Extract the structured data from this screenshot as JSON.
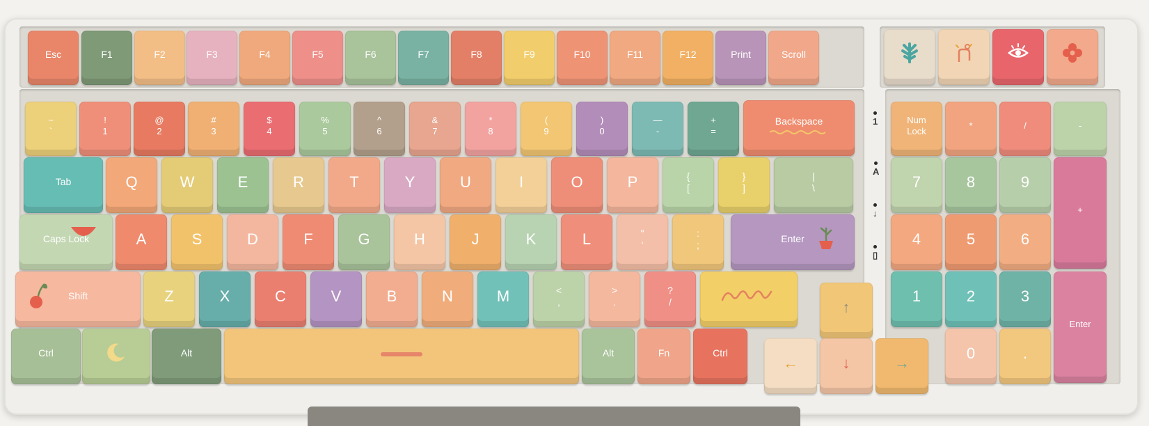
{
  "keyboard": {
    "function_row": [
      {
        "label": "Esc",
        "color": "#e9866a"
      },
      {
        "label": "F1",
        "color": "#7f9a77"
      },
      {
        "label": "F2",
        "color": "#f3be86"
      },
      {
        "label": "F3",
        "color": "#e7b2bf"
      },
      {
        "label": "F4",
        "color": "#f0a97d"
      },
      {
        "label": "F5",
        "color": "#ef8f8a"
      },
      {
        "label": "F6",
        "color": "#a9c39a"
      },
      {
        "label": "F7",
        "color": "#79b2a2"
      },
      {
        "label": "F8",
        "color": "#e47f67"
      },
      {
        "label": "F9",
        "color": "#f2cd6b"
      },
      {
        "label": "F10",
        "color": "#ef9375"
      },
      {
        "label": "F11",
        "color": "#f0a981"
      },
      {
        "label": "F12",
        "color": "#f1b063"
      },
      {
        "label": "Print",
        "color": "#b894b8"
      },
      {
        "label": "Scroll",
        "color": "#f1a78a"
      }
    ],
    "macro_keys": [
      {
        "icon": "leaf-icon",
        "color": "#e8dccb"
      },
      {
        "icon": "hand-icon",
        "color": "#f1d5b5"
      },
      {
        "icon": "eye-icon",
        "color": "#e8666b"
      },
      {
        "icon": "flower-icon",
        "color": "#f2a98c"
      }
    ],
    "number_row": [
      {
        "top": "~",
        "bottom": "`",
        "color": "#ecd07a"
      },
      {
        "top": "!",
        "bottom": "1",
        "color": "#ef8f7a"
      },
      {
        "top": "@",
        "bottom": "2",
        "color": "#e77a60"
      },
      {
        "top": "#",
        "bottom": "3",
        "color": "#f0b073"
      },
      {
        "top": "$",
        "bottom": "4",
        "color": "#ea6d72"
      },
      {
        "top": "%",
        "bottom": "5",
        "color": "#aac99c"
      },
      {
        "top": "^",
        "bottom": "6",
        "color": "#b3a08c"
      },
      {
        "top": "&",
        "bottom": "7",
        "color": "#e8a58f"
      },
      {
        "top": "*",
        "bottom": "8",
        "color": "#f2a3a0"
      },
      {
        "top": "(",
        "bottom": "9",
        "color": "#f2c672"
      },
      {
        "top": ")",
        "bottom": "0",
        "color": "#b38db9"
      },
      {
        "top": "—",
        "bottom": "-",
        "color": "#7dbab3"
      },
      {
        "top": "+",
        "bottom": "=",
        "color": "#6fa792"
      },
      {
        "top": "Backspace",
        "bottom": "",
        "color": "#ef8c6f"
      }
    ],
    "qwerty_row": [
      {
        "top": "Tab",
        "bottom": "",
        "color": "#66bdb3"
      },
      {
        "top": "Q",
        "bottom": "",
        "color": "#f2a878"
      },
      {
        "top": "W",
        "bottom": "",
        "color": "#e4cb76"
      },
      {
        "top": "E",
        "bottom": "",
        "color": "#9cc292"
      },
      {
        "top": "R",
        "bottom": "",
        "color": "#e7c98f"
      },
      {
        "top": "T",
        "bottom": "",
        "color": "#f2a98a"
      },
      {
        "top": "Y",
        "bottom": "",
        "color": "#d9a9c4"
      },
      {
        "top": "U",
        "bottom": "",
        "color": "#f1a982"
      },
      {
        "top": "I",
        "bottom": "",
        "color": "#f3d098"
      },
      {
        "top": "O",
        "bottom": "",
        "color": "#ee8e78"
      },
      {
        "top": "P",
        "bottom": "",
        "color": "#f4b69c"
      },
      {
        "top": "{",
        "bottom": "[",
        "color": "#b9d4a8"
      },
      {
        "top": "}",
        "bottom": "]",
        "color": "#e8d06b"
      },
      {
        "top": "|",
        "bottom": "\\",
        "color": "#b8cba3"
      }
    ],
    "home_row": [
      {
        "top": "Caps Lock",
        "bottom": "",
        "color": "#c4d7b3"
      },
      {
        "top": "A",
        "bottom": "",
        "color": "#ef8a6c"
      },
      {
        "top": "S",
        "bottom": "",
        "color": "#f2c26b"
      },
      {
        "top": "D",
        "bottom": "",
        "color": "#f3b79f"
      },
      {
        "top": "F",
        "bottom": "",
        "color": "#ef8b73"
      },
      {
        "top": "G",
        "bottom": "",
        "color": "#a9c39a"
      },
      {
        "top": "H",
        "bottom": "",
        "color": "#f4c6a6"
      },
      {
        "top": "J",
        "bottom": "",
        "color": "#f0b06c"
      },
      {
        "top": "K",
        "bottom": "",
        "color": "#b7d3b2"
      },
      {
        "top": "L",
        "bottom": "",
        "color": "#ef8f7b"
      },
      {
        "top": "\"",
        "bottom": "'",
        "color": "#f4bfa8"
      },
      {
        "top": ":",
        "bottom": ";",
        "color": "#f1c77b"
      },
      {
        "top": "Enter",
        "bottom": "",
        "color": "#b597c0"
      }
    ],
    "shift_row": [
      {
        "top": "Shift",
        "bottom": "",
        "color": "#f6b89f"
      },
      {
        "top": "Z",
        "bottom": "",
        "color": "#e8d27d"
      },
      {
        "top": "X",
        "bottom": "",
        "color": "#67aeaa"
      },
      {
        "top": "C",
        "bottom": "",
        "color": "#ea7f70"
      },
      {
        "top": "V",
        "bottom": "",
        "color": "#b494c2"
      },
      {
        "top": "B",
        "bottom": "",
        "color": "#f2ad90"
      },
      {
        "top": "N",
        "bottom": "",
        "color": "#f0ad7b"
      },
      {
        "top": "M",
        "bottom": "",
        "color": "#72c1b8"
      },
      {
        "top": "<",
        "bottom": ",",
        "color": "#bcd2a8"
      },
      {
        "top": ">",
        "bottom": ".",
        "color": "#f4b89e"
      },
      {
        "top": "?",
        "bottom": "/",
        "color": "#ef8f86"
      },
      {
        "top": "",
        "bottom": "",
        "color": "#f3cf67"
      }
    ],
    "bottom_row": [
      {
        "top": "Ctrl",
        "bottom": "",
        "color": "#a7bf97"
      },
      {
        "top": "",
        "bottom": "",
        "color": "#b7cd95"
      },
      {
        "top": "Alt",
        "bottom": "",
        "color": "#7f9b7a"
      },
      {
        "top": "",
        "bottom": "",
        "color": "#f2c57a"
      },
      {
        "top": "Alt",
        "bottom": "",
        "color": "#a9c39a"
      },
      {
        "top": "Fn",
        "bottom": "",
        "color": "#f0a58a"
      },
      {
        "top": "Ctrl",
        "bottom": "",
        "color": "#e7735f"
      }
    ],
    "arrows": [
      {
        "glyph": "↑",
        "color": "#f1c777"
      },
      {
        "glyph": "←",
        "color": "#f4ddc3"
      },
      {
        "glyph": "↓",
        "color": "#f4c6a6"
      },
      {
        "glyph": "→",
        "color": "#f1b96f"
      }
    ],
    "numpad": [
      {
        "top": "Num",
        "bottom": "Lock",
        "color": "#f0b478"
      },
      {
        "top": "*",
        "bottom": "",
        "color": "#f1a47f"
      },
      {
        "top": "/",
        "bottom": "",
        "color": "#ef8c7c"
      },
      {
        "top": "-",
        "bottom": "",
        "color": "#bcd3aa"
      },
      {
        "top": "7",
        "bottom": "",
        "color": "#c0d4ae"
      },
      {
        "top": "8",
        "bottom": "",
        "color": "#a7c69e"
      },
      {
        "top": "9",
        "bottom": "",
        "color": "#b6ceaa"
      },
      {
        "top": "+",
        "bottom": "",
        "color": "#d97a9b"
      },
      {
        "top": "4",
        "bottom": "",
        "color": "#f3a880"
      },
      {
        "top": "5",
        "bottom": "",
        "color": "#ef9b72"
      },
      {
        "top": "6",
        "bottom": "",
        "color": "#f2ad82"
      },
      {
        "top": "1",
        "bottom": "",
        "color": "#6fbfae"
      },
      {
        "top": "2",
        "bottom": "",
        "color": "#6fc1b7"
      },
      {
        "top": "3",
        "bottom": "",
        "color": "#6fb3a6"
      },
      {
        "top": "Enter",
        "bottom": "",
        "color": "#da82a0"
      },
      {
        "top": "0",
        "bottom": "",
        "color": "#f4c4ab"
      },
      {
        "top": ".",
        "bottom": "",
        "color": "#f2c77e"
      }
    ],
    "indicators": [
      {
        "label": "1"
      },
      {
        "label": "A"
      },
      {
        "label": "↓"
      },
      {
        "label": "▯"
      }
    ]
  }
}
